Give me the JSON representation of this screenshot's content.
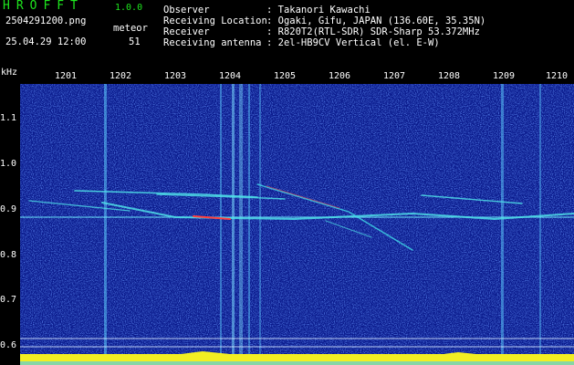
{
  "header": {
    "app_title": "HROFFT",
    "app_version": "1.0.0",
    "file_name": "2504291200.png",
    "datetime": "25.04.29 12:00",
    "meteor_label": "meteor",
    "meteor_count": "51",
    "info_labels": "Observer\nReceiving Location\nReceiver\nReceiving antenna",
    "info_values": ": Takanori Kawachi\n: Ogaki, Gifu, JAPAN (136.60E, 35.35N)\n: R820T2(RTL-SDR) SDR-Sharp 53.372MHz\n: 2el-HB9CV Vertical (el. E-W)"
  },
  "axis": {
    "unit": "kHz",
    "hours": [
      "1201",
      "1202",
      "1203",
      "1204",
      "1205",
      "1206",
      "1207",
      "1208",
      "1209",
      "1210"
    ],
    "freq_labels": [
      "1.1",
      "1.0",
      "0.9",
      "0.8",
      "0.7",
      "0.6"
    ]
  },
  "colors": {
    "background": "#0a1a8c",
    "noise": "#1c3fd2",
    "signal": "#3fd8e8",
    "hot": "#ff4040",
    "amplitude": "#f2ee22",
    "title": "#1ee61e"
  }
}
